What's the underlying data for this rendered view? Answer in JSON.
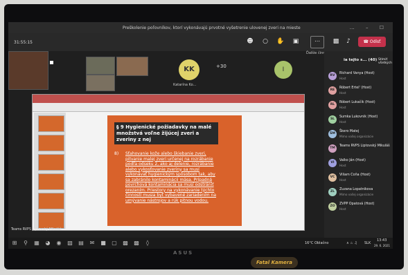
{
  "window": {
    "title": "Preškolenie poľovníkov, ktorí vykonávajú prvotné vyšetrenie ulovenej zveri na mieste",
    "controls": "… – ☐"
  },
  "toolbar": {
    "timer": "31:55:15",
    "more_label": "Ďalšie činnosti",
    "leave_label": "Odísť"
  },
  "meeting": {
    "kk_initials": "KK",
    "kk_name": "Katarína Ko...",
    "more_count": "+30",
    "i_initial": "I",
    "presenter_label": "Teams RVPS Liptovský Mikuláš"
  },
  "slide": {
    "title": "§ 9 Hygienické požiadavky na malé množstvá voľne žijúcej zveri a zveriny z nej",
    "number": "8)",
    "body": "Sťahovanie kože alebo škiebanie zveri, pitvanie malej zveri určenej na rozrábanie podľa odseku 2, ako aj delenie, rozrábanie alebo vykosťovanie zveriny sa musí vykonávať hygienickým spôsobom tak, aby sa zabránilo kontaminácii mäsa. Prípadná povrchová kontaminácia sa musí odstrániť orezaním. Priestory na vykonávanie týchto činností musia byť vybavené zariadením na umývanie nástrojov a rúk pitnou vodou."
  },
  "panel": {
    "header": "ia tejto s... (40)",
    "mute_all": "Stlmiť všetkých",
    "participants": [
      {
        "initials": "RV",
        "name": "Richard Vanya (Host)",
        "role": "Host",
        "color": "#b8a0d8"
      },
      {
        "initials": "RE",
        "name": "Róbert Ertel' (Host)",
        "role": "Host",
        "color": "#e0a0a0"
      },
      {
        "initials": "RL",
        "name": "Róbert Lukačík (Host)",
        "role": "Host",
        "color": "#e0a0a0"
      },
      {
        "initials": "SL",
        "name": "Sumka Lukovnik (Host)",
        "role": "Host",
        "color": "#a0d0a0"
      },
      {
        "initials": "ŠM",
        "name": "Škero Matej",
        "role": "Mimo vašej organizácie",
        "color": "#a0c0e0"
      },
      {
        "initials": "TM",
        "name": "Teams RVPS Liptovský Mikuláš",
        "role": "",
        "color": "#d0a0c0"
      },
      {
        "initials": "VI",
        "name": "Valko Ján (Host)",
        "role": "Host",
        "color": "#a0a0e0"
      },
      {
        "initials": "VC",
        "name": "Viliam Coňa (Host)",
        "role": "Host",
        "color": "#e0c0a0"
      },
      {
        "initials": "ZL",
        "name": "Zuzana Lopatnikova",
        "role": "Mimo vašej organizácie",
        "color": "#a0d0c0"
      },
      {
        "initials": "ZO",
        "name": "ZVPP Opatová (Host)",
        "role": "Host",
        "color": "#c0d0a0"
      }
    ]
  },
  "taskbar": {
    "weather": "16°C Oblačno",
    "lang": "SLK",
    "time": "13:43",
    "date": "29. 6. 2021"
  },
  "monitor": {
    "brand": "ASUS",
    "sticker": "Fatal Kamera"
  }
}
